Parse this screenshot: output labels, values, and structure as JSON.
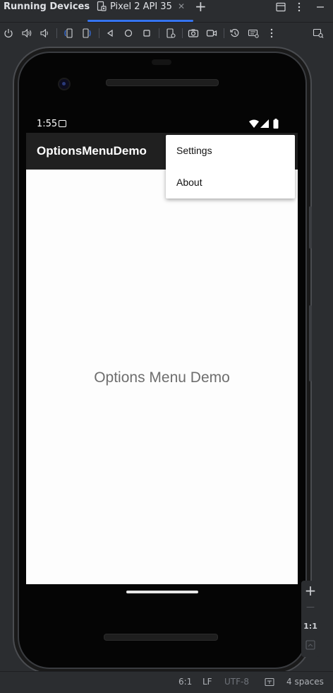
{
  "ide": {
    "panel_title": "Running Devices",
    "device_tab_label": "Pixel 2 API 35",
    "tab_close": "✕",
    "tab_add": "+"
  },
  "device": {
    "status_time": "1:55"
  },
  "app": {
    "title": "OptionsMenuDemo",
    "center_text": "Options Menu Demo",
    "menu_items": [
      "Settings",
      "About"
    ]
  },
  "zoom": {
    "plus": "+",
    "minus": "—",
    "actual": "1:1"
  },
  "statusbar": {
    "position": "6:1",
    "line_ending": "LF",
    "encoding": "UTF-8",
    "indent": "4 spaces"
  },
  "colors": {
    "accent": "#3574f0",
    "ide_bg": "#2b2d30",
    "app_bar": "#202020",
    "content_bg": "#fdfdfd"
  }
}
